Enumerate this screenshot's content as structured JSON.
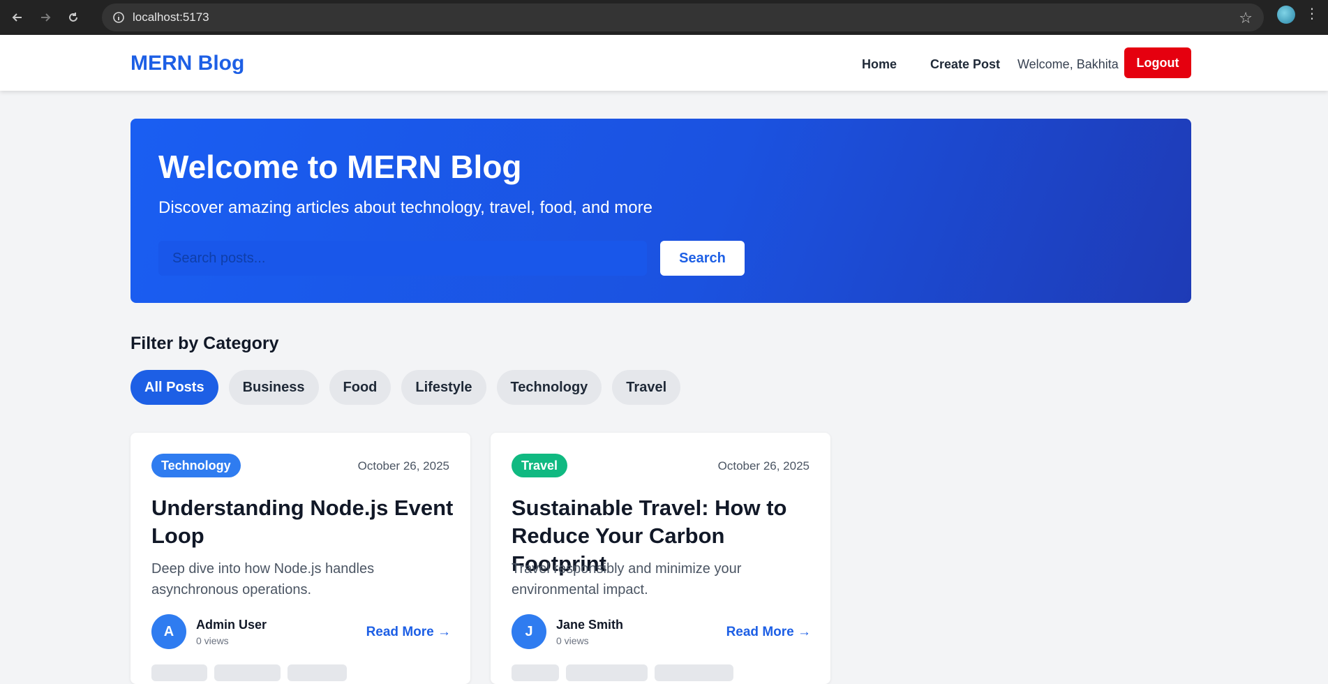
{
  "browser": {
    "url": "localhost:5173",
    "icons": {
      "back": "arrow-left-icon",
      "forward": "arrow-right-icon",
      "reload": "reload-icon",
      "info": "info-icon",
      "bookmark": "star-icon",
      "menu": "more-vert-icon"
    }
  },
  "navbar": {
    "brand": "MERN Blog",
    "home": "Home",
    "create": "Create Post",
    "welcome": "Welcome, Bakhita",
    "logout": "Logout"
  },
  "hero": {
    "title": "Welcome to MERN Blog",
    "subtitle": "Discover amazing articles about technology, travel, food, and more",
    "search_placeholder": "Search posts...",
    "search_button": "Search"
  },
  "filter": {
    "title": "Filter by Category",
    "categories": [
      "All Posts",
      "Business",
      "Food",
      "Lifestyle",
      "Technology",
      "Travel"
    ],
    "active": "All Posts"
  },
  "posts": [
    {
      "category": "Technology",
      "category_color": "#2f7cf0",
      "date": "October 26, 2025",
      "title": "Understanding Node.js Event Loop",
      "excerpt": "Deep dive into how Node.js handles asynchronous operations.",
      "author_initial": "A",
      "author": "Admin User",
      "views": "0 views",
      "read_more": "Read More →"
    },
    {
      "category": "Travel",
      "category_color": "#10b981",
      "date": "October 26, 2025",
      "title": "Sustainable Travel: How to Reduce Your Carbon Footprint",
      "excerpt": "Travel responsibly and minimize your environmental impact.",
      "author_initial": "J",
      "author": "Jane Smith",
      "views": "0 views",
      "read_more": "Read More →"
    }
  ],
  "colors": {
    "primary": "#1d5fe5",
    "logout": "#e5000f"
  }
}
